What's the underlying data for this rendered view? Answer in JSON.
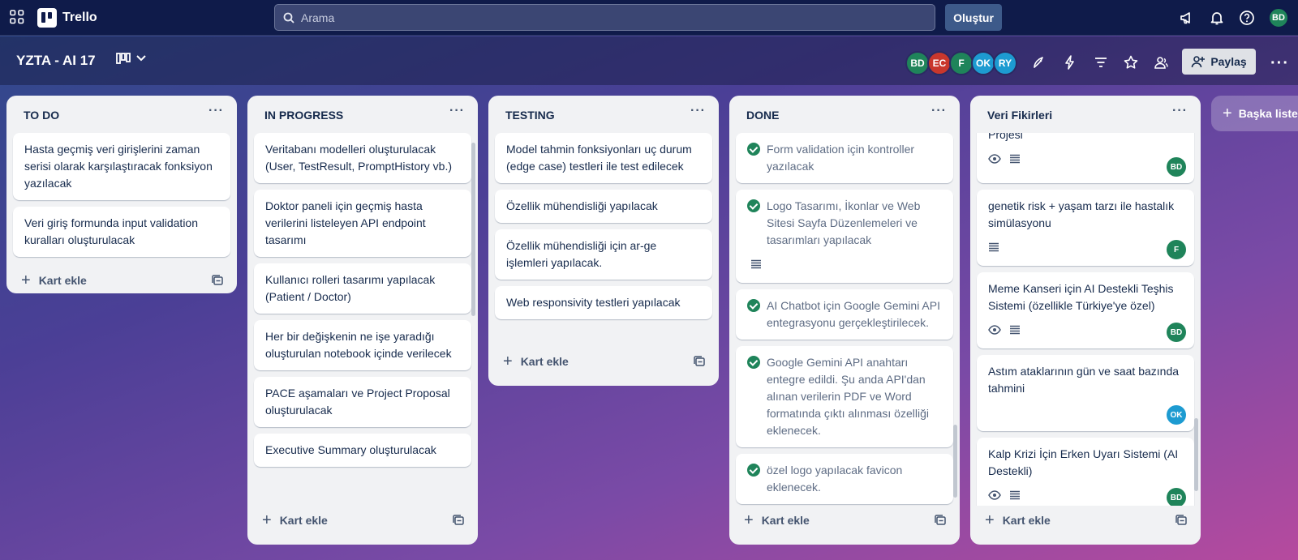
{
  "topbar": {
    "app_name": "Trello",
    "search_placeholder": "Arama",
    "create_label": "Oluştur",
    "user_initials": "BD",
    "user_color": "#1f845a"
  },
  "board": {
    "title": "YZTA - AI 17",
    "members": [
      {
        "initials": "BD",
        "color": "#1f845a"
      },
      {
        "initials": "EC",
        "color": "#c9372c"
      },
      {
        "initials": "F",
        "color": "#1f845a"
      },
      {
        "initials": "OK",
        "color": "#1d9bd1"
      },
      {
        "initials": "RY",
        "color": "#1d9bd1"
      }
    ],
    "share_label": "Paylaş",
    "add_list_label": "Başka liste ekle"
  },
  "colors": {
    "done_check": "#1f845a",
    "list_bg": "#f1f2f4",
    "topbar_bg": "#0f1b4a"
  },
  "lists": [
    {
      "title": "TO DO",
      "add_label": "Kart ekle",
      "cards": [
        {
          "text": "Hasta geçmiş veri girişlerini zaman serisi olarak karşılaştıracak fonksiyon yazılacak"
        },
        {
          "text": "Veri giriş formunda input validation kuralları oluşturulacak"
        }
      ]
    },
    {
      "title": "IN PROGRESS",
      "add_label": "Kart ekle",
      "cards": [
        {
          "text": "Veritabanı modelleri oluşturulacak (User, TestResult, PromptHistory vb.)"
        },
        {
          "text": "Doktor paneli için geçmiş hasta verilerini listeleyen API endpoint tasarımı"
        },
        {
          "text": "Kullanıcı rolleri tasarımı yapılacak (Patient / Doctor)"
        },
        {
          "text": "Her bir değişkenin ne işe yaradığı oluşturulan notebook içinde verilecek"
        },
        {
          "text": "PACE aşamaları ve Project Proposal oluşturulacak"
        },
        {
          "text": "Executive Summary oluşturulacak"
        }
      ]
    },
    {
      "title": "TESTING",
      "add_label": "Kart ekle",
      "cards": [
        {
          "text": "Model tahmin fonksiyonları uç durum (edge case) testleri ile test edilecek"
        },
        {
          "text": "Özellik mühendisliği yapılacak"
        },
        {
          "text": "Özellik mühendisliği için ar-ge işlemleri yapılacak."
        },
        {
          "text": "Web responsivity testleri yapılacak"
        }
      ]
    },
    {
      "title": "DONE",
      "add_label": "Kart ekle",
      "cards": [
        {
          "text": "Form validation için kontroller yazılacak",
          "description": false
        },
        {
          "text": "Logo Tasarımı, İkonlar ve Web Sitesi Sayfa Düzenlemeleri ve tasarımları yapılacak",
          "description": true
        },
        {
          "text": "AI Chatbot için Google Gemini API entegrasyonu gerçekleştirilecek.",
          "description": false
        },
        {
          "text": "Google Gemini API anahtarı entegre edildi. Şu anda API'dan alınan verilerin PDF ve Word formatında çıktı alınması özelliği eklenecek.",
          "description": false
        },
        {
          "text": "özel logo yapılacak favicon eklenecek.",
          "description": false
        }
      ]
    },
    {
      "title": "Veri Fikirleri",
      "add_label": "Kart ekle",
      "cards": [
        {
          "text": "Projesi",
          "watch": true,
          "member": "BD",
          "member_color": "#1f845a"
        },
        {
          "text": "genetik risk + yaşam tarzı ile hastalık simülasyonu",
          "watch": false,
          "member": "F",
          "member_color": "#1f845a"
        },
        {
          "text": "Meme Kanseri için AI Destekli Teşhis Sistemi (özellikle Türkiye'ye özel)",
          "watch": true,
          "member": "BD",
          "member_color": "#1f845a"
        },
        {
          "text": "Astım ataklarının gün ve saat bazında tahmini",
          "watch": false,
          "member": "OK",
          "member_color": "#1d9bd1"
        },
        {
          "text": "Kalp Krizi İçin Erken Uyarı Sistemi (AI Destekli)",
          "watch": true,
          "member": "BD",
          "member_color": "#1f845a"
        }
      ]
    }
  ]
}
